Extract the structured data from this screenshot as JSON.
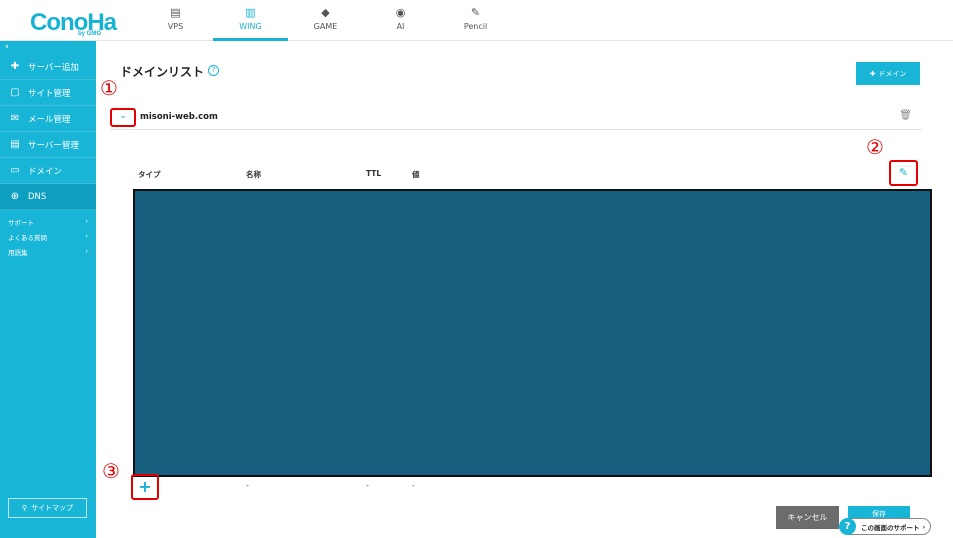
{
  "logo": {
    "text": "ConoHa",
    "sub": "by GMO"
  },
  "nav": [
    {
      "label": "VPS",
      "icon": "server-icon"
    },
    {
      "label": "WING",
      "icon": "wing-icon",
      "active": true
    },
    {
      "label": "GAME",
      "icon": "gamepad-icon"
    },
    {
      "label": "AI",
      "icon": "ai-icon"
    },
    {
      "label": "Pencil",
      "icon": "pencil-doc-icon"
    }
  ],
  "sidebar": {
    "collapse": "‹",
    "items": [
      {
        "label": "サーバー追加",
        "icon": "plus-icon"
      },
      {
        "label": "サイト管理",
        "icon": "site-icon"
      },
      {
        "label": "メール管理",
        "icon": "mail-icon"
      },
      {
        "label": "サーバー管理",
        "icon": "server-manage-icon"
      },
      {
        "label": "ドメイン",
        "icon": "domain-icon"
      },
      {
        "label": "DNS",
        "icon": "globe-icon",
        "active": true
      }
    ],
    "links": [
      "サポート",
      "よくある質問",
      "用語集"
    ],
    "sitemap": "サイトマップ"
  },
  "main": {
    "title": "ドメインリスト",
    "help": "?",
    "add_domain": "ドメイン",
    "domain": "misoni-web.com",
    "columns": [
      "タイプ",
      "名称",
      "TTL",
      "値"
    ],
    "dashes": [
      "-",
      "-",
      "-"
    ],
    "cancel": "キャンセル",
    "save": "保存",
    "support": "この画面のサポート"
  },
  "markers": [
    "①",
    "②",
    "③"
  ],
  "colors": {
    "accent": "#19b5d6",
    "highlight": "#e30000",
    "block": "#165f7f"
  }
}
